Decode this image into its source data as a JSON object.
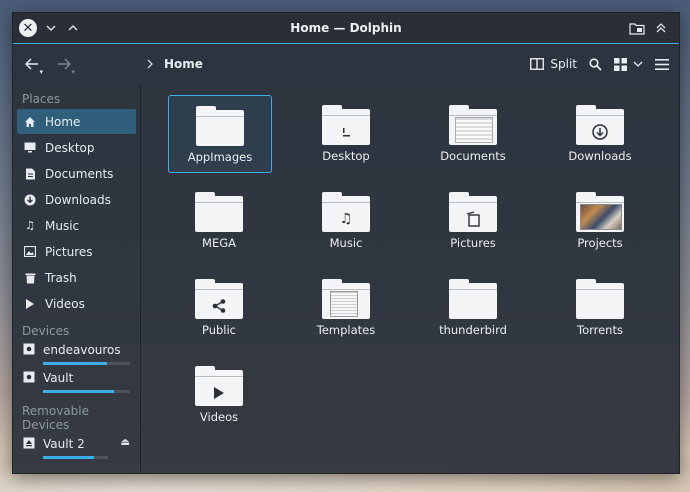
{
  "window": {
    "title": "Home — Dolphin"
  },
  "toolbar": {
    "location": "Home",
    "split_label": "Split"
  },
  "sidebar": {
    "places_header": "Places",
    "places": [
      {
        "label": "Home",
        "icon": "home-icon"
      },
      {
        "label": "Desktop",
        "icon": "desktop-icon"
      },
      {
        "label": "Documents",
        "icon": "documents-icon"
      },
      {
        "label": "Downloads",
        "icon": "downloads-icon"
      },
      {
        "label": "Music",
        "icon": "music-icon"
      },
      {
        "label": "Pictures",
        "icon": "pictures-icon"
      },
      {
        "label": "Trash",
        "icon": "trash-icon"
      },
      {
        "label": "Videos",
        "icon": "videos-icon"
      }
    ],
    "devices_header": "Devices",
    "devices": [
      {
        "label": "endeavouros",
        "usage": 0.73
      },
      {
        "label": "Vault",
        "usage": 0.82
      }
    ],
    "removable_header": "Removable Devices",
    "removable": [
      {
        "label": "Vault 2",
        "usage": 0.78
      }
    ]
  },
  "files": [
    {
      "name": "AppImages",
      "emblem": ""
    },
    {
      "name": "Desktop",
      "emblem": "desktop-emblem-icon"
    },
    {
      "name": "Documents",
      "emblem": "documents-preview"
    },
    {
      "name": "Downloads",
      "emblem": "download-emblem-icon"
    },
    {
      "name": "MEGA",
      "emblem": ""
    },
    {
      "name": "Music",
      "emblem": "music-emblem-icon"
    },
    {
      "name": "Pictures",
      "emblem": "pictures-emblem-icon"
    },
    {
      "name": "Projects",
      "emblem": "projects-preview"
    },
    {
      "name": "Public",
      "emblem": "share-emblem-icon"
    },
    {
      "name": "Templates",
      "emblem": "templates-preview"
    },
    {
      "name": "thunderbird",
      "emblem": ""
    },
    {
      "name": "Torrents",
      "emblem": ""
    },
    {
      "name": "Videos",
      "emblem": "video-emblem-icon"
    }
  ],
  "colors": {
    "accent": "#3daee9",
    "window_bg": "#2a303a",
    "selection": "#2f5f7a"
  }
}
